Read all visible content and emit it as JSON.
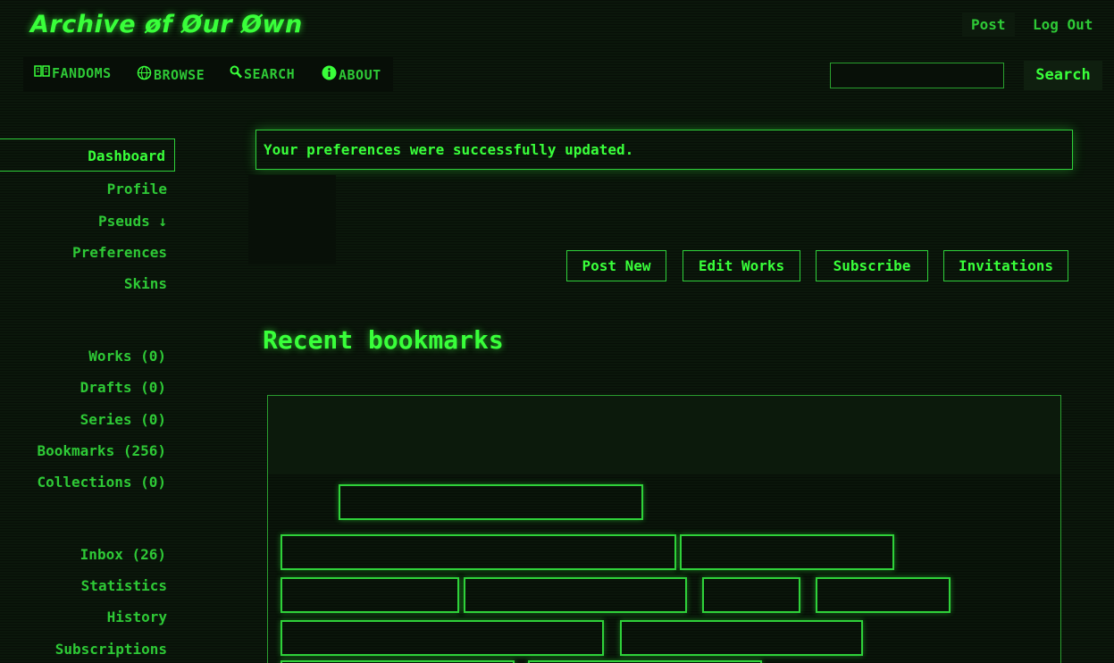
{
  "header": {
    "logo": "Archive øf Øur Øwn",
    "post_label": "Post",
    "logout_label": "Log Out"
  },
  "nav": {
    "items": [
      {
        "label": "FANDOMS",
        "icon": "book-icon"
      },
      {
        "label": "BROWSE",
        "icon": "globe-icon"
      },
      {
        "label": "SEARCH",
        "icon": "magnifier-icon"
      },
      {
        "label": "ABOUT",
        "icon": "info-icon"
      }
    ],
    "search_button": "Search",
    "search_value": ""
  },
  "sidebar": {
    "dashboard": "Dashboard",
    "group1": [
      "Profile",
      "Pseuds ↓",
      "Preferences",
      "Skins"
    ],
    "group2": [
      "Works (0)",
      "Drafts (0)",
      "Series (0)",
      "Bookmarks (256)",
      "Collections (0)"
    ],
    "group3": [
      "Inbox (26)",
      "Statistics",
      "History",
      "Subscriptions"
    ]
  },
  "main": {
    "flash": "Your preferences were successfully updated.",
    "actions": [
      "Post New",
      "Edit Works",
      "Subscribe",
      "Invitations"
    ],
    "recent_heading": "Recent bookmarks"
  },
  "colors": {
    "accent": "#39ff3a",
    "text": "#2ec936",
    "background": "#0b170b"
  }
}
